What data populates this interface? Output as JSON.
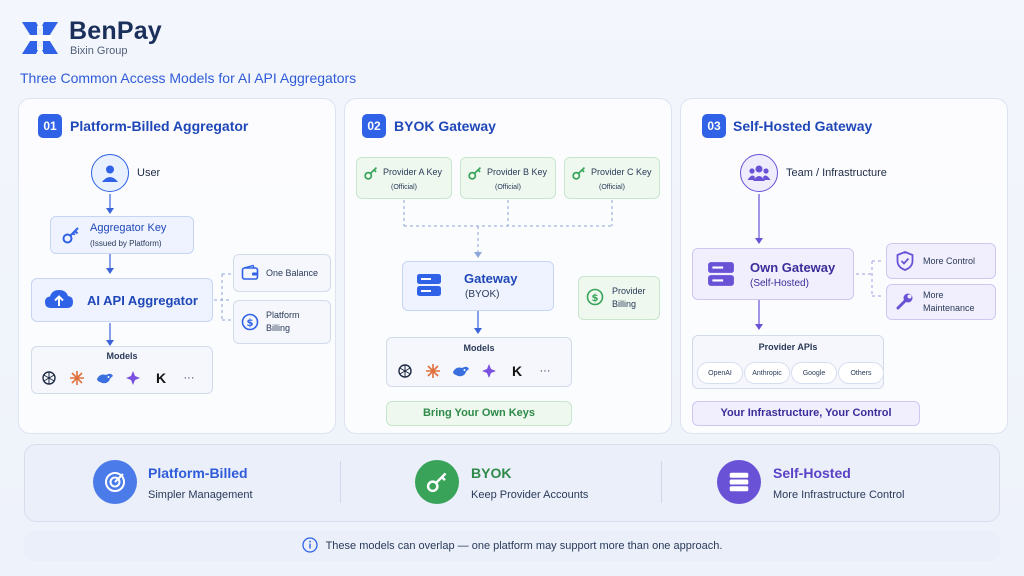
{
  "header": {
    "brand": "BenPay",
    "brand_sub": "Bixin Group",
    "subtitle": "Three Common Access Models for AI API Aggregators"
  },
  "colors": {
    "primary_blue": "#2f62e6",
    "green": "#3aa35a",
    "purple": "#6a52d6",
    "background": "#f3f6fc"
  },
  "panel1": {
    "number": "01",
    "title": "Platform-Billed Aggregator",
    "user_label": "User",
    "key_title": "Aggregator Key",
    "key_sub": "(Issued by Platform)",
    "aggregator_label": "AI API Aggregator",
    "balance_label": "One Balance",
    "billing_label_1": "Platform",
    "billing_label_2": "Billing",
    "models_label": "Models",
    "models_more": "···"
  },
  "panel2": {
    "number": "02",
    "title": "BYOK Gateway",
    "providers": [
      {
        "name": "Provider A Key",
        "sub": "(Official)"
      },
      {
        "name": "Provider B Key",
        "sub": "(Official)"
      },
      {
        "name": "Provider C Key",
        "sub": "(Official)"
      }
    ],
    "gateway_label": "Gateway",
    "gateway_sub": "(BYOK)",
    "billing_label_1": "Provider",
    "billing_label_2": "Billing",
    "models_label": "Models",
    "models_more": "···",
    "footer": "Bring Your Own Keys"
  },
  "panel3": {
    "number": "03",
    "title": "Self-Hosted Gateway",
    "team_label": "Team / Infrastructure",
    "gateway_label": "Own Gateway",
    "gateway_sub": "(Self-Hosted)",
    "control_label": "More Control",
    "maint_label_1": "More",
    "maint_label_2": "Maintenance",
    "provider_apis_label": "Provider APIs",
    "apis": [
      "OpenAI",
      "Anthropic",
      "Google",
      "Others"
    ],
    "footer": "Your Infrastructure, Your Control"
  },
  "summary": [
    {
      "title": "Platform-Billed",
      "sub": "Simpler Management",
      "icon": "target-icon",
      "color": "#4a7be8"
    },
    {
      "title": "BYOK",
      "sub": "Keep Provider Accounts",
      "icon": "key-icon",
      "color": "#3aa35a"
    },
    {
      "title": "Self-Hosted",
      "sub": "More Infrastructure Control",
      "icon": "server-icon",
      "color": "#6a52d6"
    }
  ],
  "note": "These models can overlap — one platform may support more than one approach."
}
